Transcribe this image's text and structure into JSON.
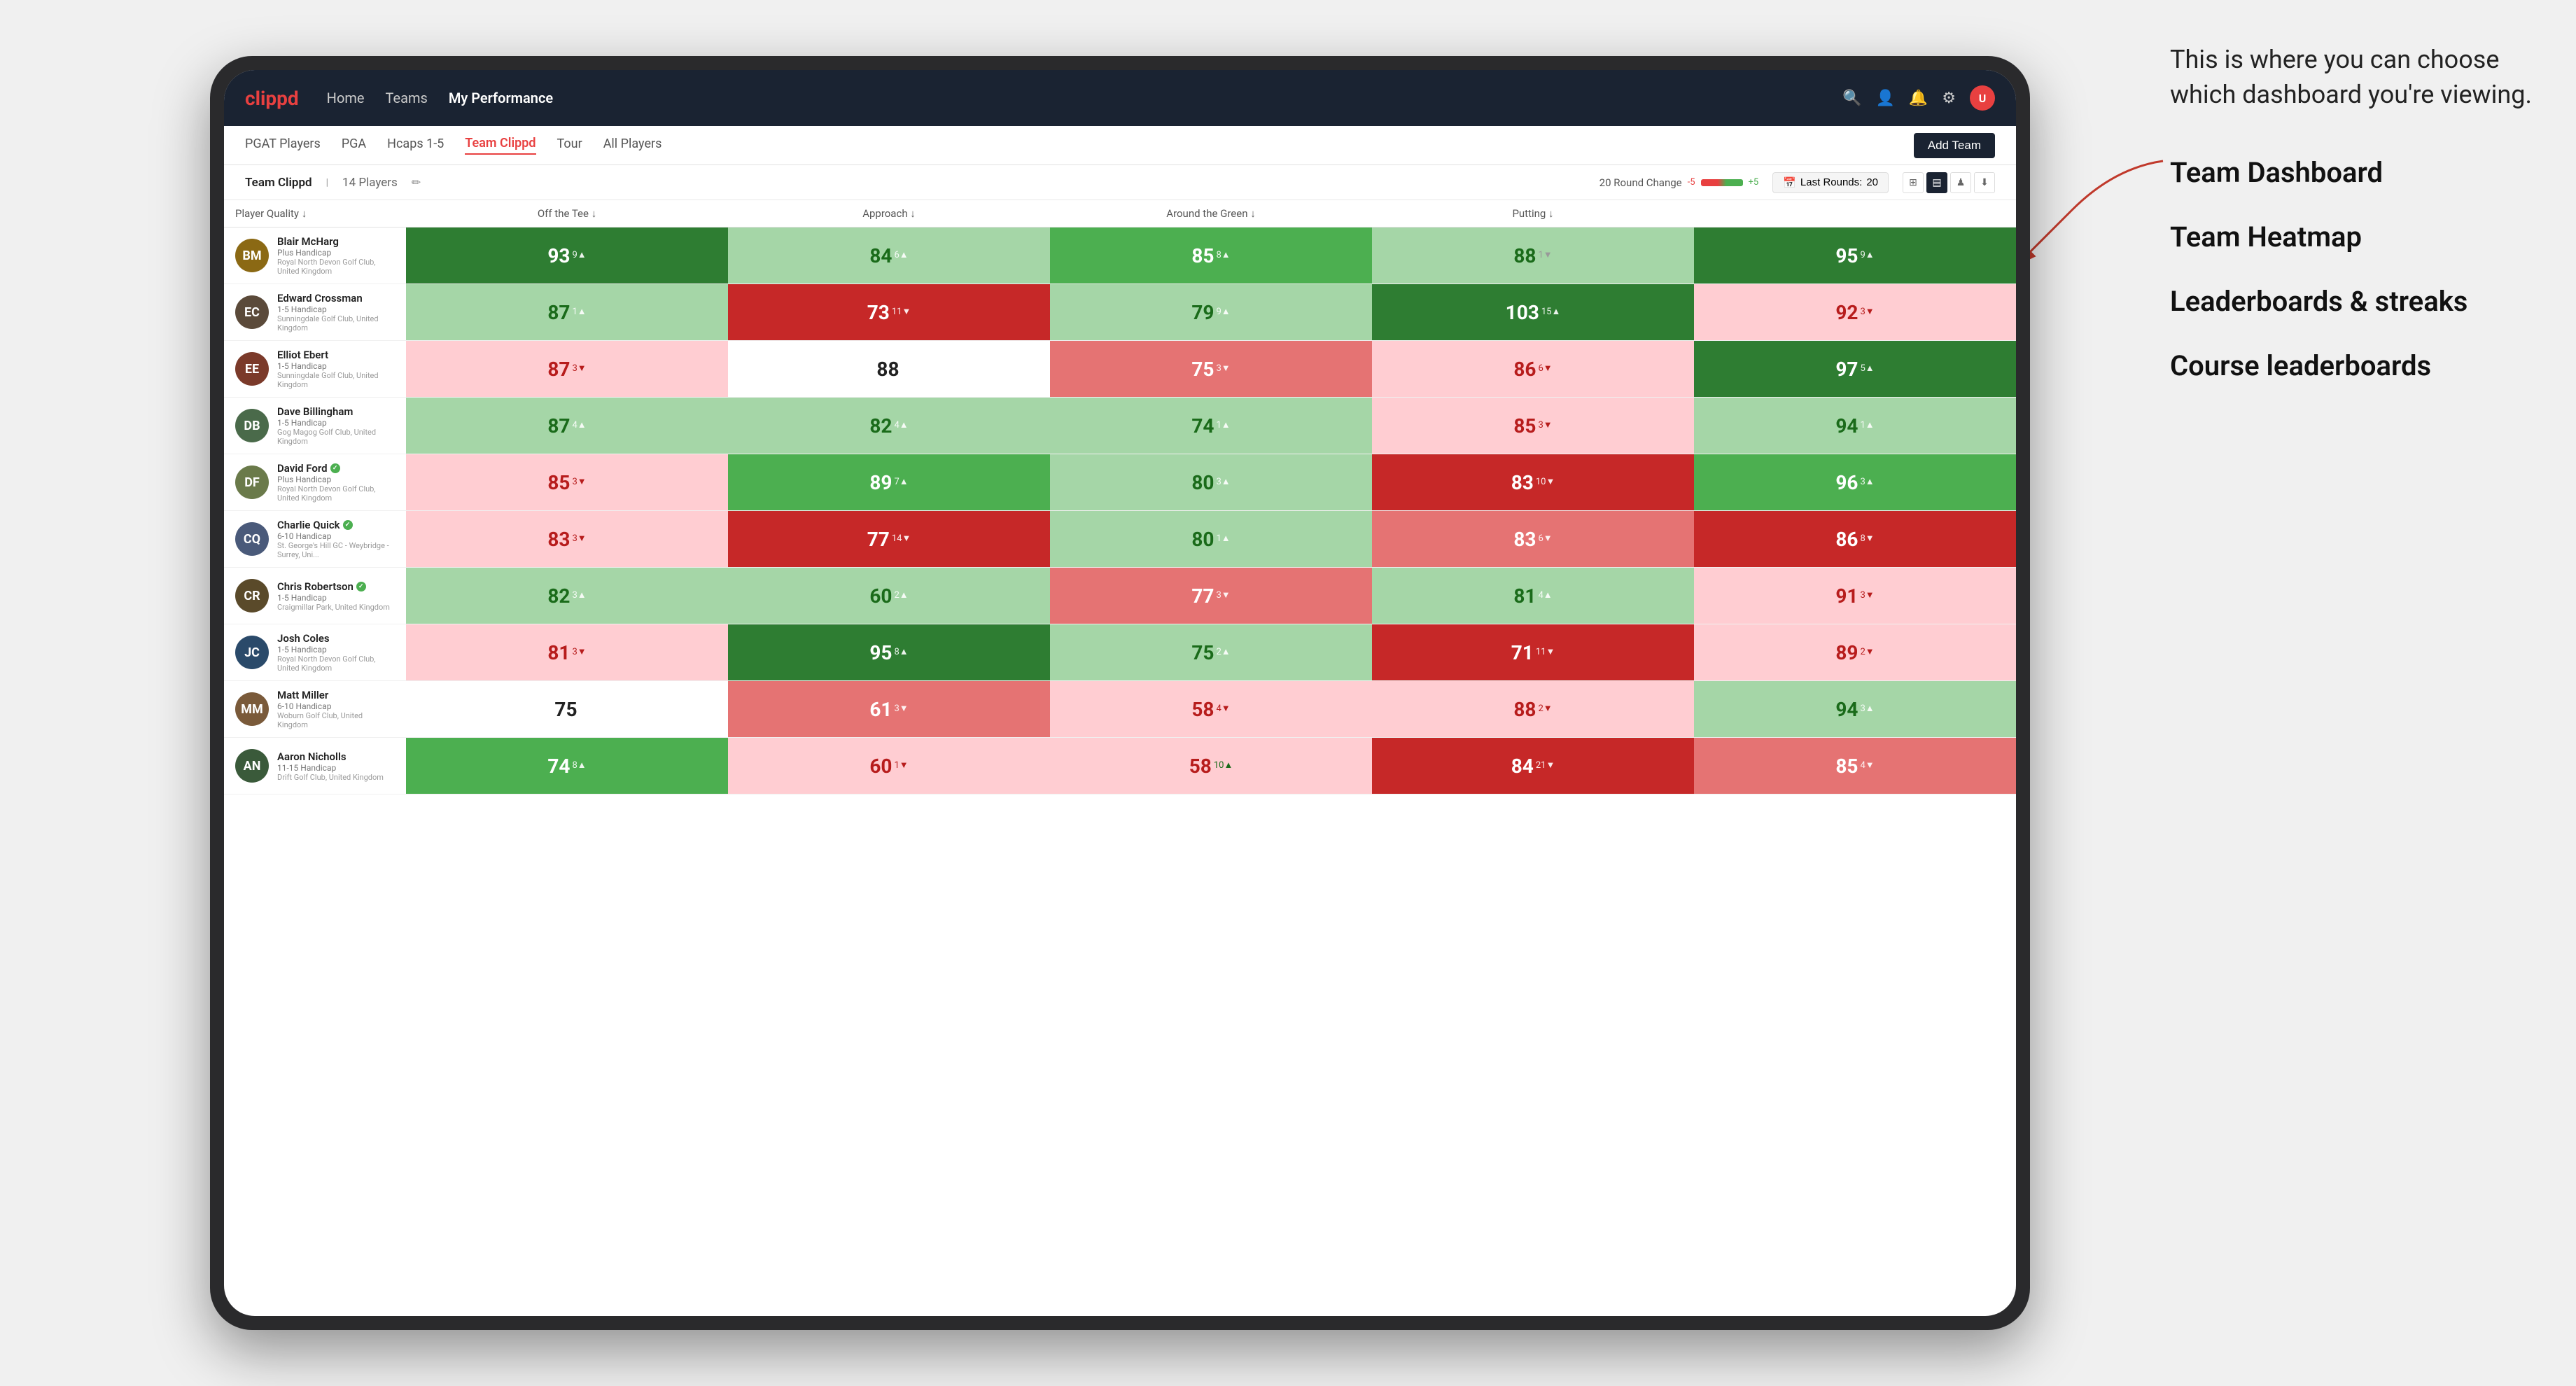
{
  "annotation": {
    "callout": "This is where you can choose which dashboard you're viewing.",
    "items": [
      "Team Dashboard",
      "Team Heatmap",
      "Leaderboards & streaks",
      "Course leaderboards"
    ]
  },
  "nav": {
    "logo": "clippd",
    "links": [
      "Home",
      "Teams",
      "My Performance"
    ],
    "active_link": "My Performance"
  },
  "sub_tabs": {
    "tabs": [
      "PGAT Players",
      "PGA",
      "Hcaps 1-5",
      "Team Clippd",
      "Tour",
      "All Players"
    ],
    "active": "Team Clippd",
    "add_btn": "Add Team"
  },
  "team_bar": {
    "name": "Team Clippd",
    "count": "14 Players",
    "round_change_label": "20 Round Change",
    "neg_value": "-5",
    "pos_value": "+5",
    "last_rounds_label": "Last Rounds:",
    "last_rounds_value": "20"
  },
  "columns": {
    "player_col": "Player Quality ↓",
    "cols": [
      "Off the Tee ↓",
      "Approach ↓",
      "Around the Green ↓",
      "Putting ↓"
    ]
  },
  "players": [
    {
      "name": "Blair McHarg",
      "handicap": "Plus Handicap",
      "club": "Royal North Devon Golf Club, United Kingdom",
      "initials": "BM",
      "avatar_color": "#8B6914",
      "scores": [
        {
          "value": 93,
          "change": "9",
          "dir": "up",
          "bg": "bg-green-strong"
        },
        {
          "value": 84,
          "change": "6",
          "dir": "up",
          "bg": "bg-green-light"
        },
        {
          "value": 85,
          "change": "8",
          "dir": "up",
          "bg": "bg-green-medium"
        },
        {
          "value": 88,
          "change": "1",
          "dir": "down",
          "bg": "bg-green-light"
        },
        {
          "value": 95,
          "change": "9",
          "dir": "up",
          "bg": "bg-green-strong"
        }
      ]
    },
    {
      "name": "Edward Crossman",
      "handicap": "1-5 Handicap",
      "club": "Sunningdale Golf Club, United Kingdom",
      "initials": "EC",
      "avatar_color": "#5B4A3A",
      "scores": [
        {
          "value": 87,
          "change": "1",
          "dir": "up",
          "bg": "bg-green-light"
        },
        {
          "value": 73,
          "change": "11",
          "dir": "down",
          "bg": "bg-red-strong"
        },
        {
          "value": 79,
          "change": "9",
          "dir": "up",
          "bg": "bg-green-light"
        },
        {
          "value": 103,
          "change": "15",
          "dir": "up",
          "bg": "bg-green-strong"
        },
        {
          "value": 92,
          "change": "3",
          "dir": "down",
          "bg": "bg-red-light"
        }
      ]
    },
    {
      "name": "Elliot Ebert",
      "handicap": "1-5 Handicap",
      "club": "Sunningdale Golf Club, United Kingdom",
      "initials": "EE",
      "avatar_color": "#7B3A2A",
      "scores": [
        {
          "value": 87,
          "change": "3",
          "dir": "down",
          "bg": "bg-red-light"
        },
        {
          "value": 88,
          "change": "",
          "dir": "",
          "bg": "bg-white"
        },
        {
          "value": 75,
          "change": "3",
          "dir": "down",
          "bg": "bg-red-medium"
        },
        {
          "value": 86,
          "change": "6",
          "dir": "down",
          "bg": "bg-red-light"
        },
        {
          "value": 97,
          "change": "5",
          "dir": "up",
          "bg": "bg-green-strong"
        }
      ]
    },
    {
      "name": "Dave Billingham",
      "handicap": "1-5 Handicap",
      "club": "Gog Magog Golf Club, United Kingdom",
      "initials": "DB",
      "avatar_color": "#4A6A4A",
      "scores": [
        {
          "value": 87,
          "change": "4",
          "dir": "up",
          "bg": "bg-green-light"
        },
        {
          "value": 82,
          "change": "4",
          "dir": "up",
          "bg": "bg-green-light"
        },
        {
          "value": 74,
          "change": "1",
          "dir": "up",
          "bg": "bg-green-light"
        },
        {
          "value": 85,
          "change": "3",
          "dir": "down",
          "bg": "bg-red-light"
        },
        {
          "value": 94,
          "change": "1",
          "dir": "up",
          "bg": "bg-green-light"
        }
      ]
    },
    {
      "name": "David Ford",
      "handicap": "Plus Handicap",
      "club": "Royal North Devon Golf Club, United Kingdom",
      "initials": "DF",
      "avatar_color": "#6A7A4A",
      "verified": true,
      "scores": [
        {
          "value": 85,
          "change": "3",
          "dir": "down",
          "bg": "bg-red-light"
        },
        {
          "value": 89,
          "change": "7",
          "dir": "up",
          "bg": "bg-green-medium"
        },
        {
          "value": 80,
          "change": "3",
          "dir": "up",
          "bg": "bg-green-light"
        },
        {
          "value": 83,
          "change": "10",
          "dir": "down",
          "bg": "bg-red-strong"
        },
        {
          "value": 96,
          "change": "3",
          "dir": "up",
          "bg": "bg-green-medium"
        }
      ]
    },
    {
      "name": "Charlie Quick",
      "handicap": "6-10 Handicap",
      "club": "St. George's Hill GC - Weybridge - Surrey, Uni...",
      "initials": "CQ",
      "avatar_color": "#4A5A7A",
      "verified": true,
      "scores": [
        {
          "value": 83,
          "change": "3",
          "dir": "down",
          "bg": "bg-red-light"
        },
        {
          "value": 77,
          "change": "14",
          "dir": "down",
          "bg": "bg-red-strong"
        },
        {
          "value": 80,
          "change": "1",
          "dir": "up",
          "bg": "bg-green-light"
        },
        {
          "value": 83,
          "change": "6",
          "dir": "down",
          "bg": "bg-red-medium"
        },
        {
          "value": 86,
          "change": "8",
          "dir": "down",
          "bg": "bg-red-strong"
        }
      ]
    },
    {
      "name": "Chris Robertson",
      "handicap": "1-5 Handicap",
      "club": "Craigmillar Park, United Kingdom",
      "initials": "CR",
      "avatar_color": "#5A4A2A",
      "verified": true,
      "scores": [
        {
          "value": 82,
          "change": "3",
          "dir": "up",
          "bg": "bg-green-light"
        },
        {
          "value": 60,
          "change": "2",
          "dir": "up",
          "bg": "bg-green-light"
        },
        {
          "value": 77,
          "change": "3",
          "dir": "down",
          "bg": "bg-red-medium"
        },
        {
          "value": 81,
          "change": "4",
          "dir": "up",
          "bg": "bg-green-light"
        },
        {
          "value": 91,
          "change": "3",
          "dir": "down",
          "bg": "bg-red-light"
        }
      ]
    },
    {
      "name": "Josh Coles",
      "handicap": "1-5 Handicap",
      "club": "Royal North Devon Golf Club, United Kingdom",
      "initials": "JC",
      "avatar_color": "#2A4A6A",
      "scores": [
        {
          "value": 81,
          "change": "3",
          "dir": "down",
          "bg": "bg-red-light"
        },
        {
          "value": 95,
          "change": "8",
          "dir": "up",
          "bg": "bg-green-strong"
        },
        {
          "value": 75,
          "change": "2",
          "dir": "up",
          "bg": "bg-green-light"
        },
        {
          "value": 71,
          "change": "11",
          "dir": "down",
          "bg": "bg-red-strong"
        },
        {
          "value": 89,
          "change": "2",
          "dir": "down",
          "bg": "bg-red-light"
        }
      ]
    },
    {
      "name": "Matt Miller",
      "handicap": "6-10 Handicap",
      "club": "Woburn Golf Club, United Kingdom",
      "initials": "MM",
      "avatar_color": "#7A5A3A",
      "scores": [
        {
          "value": 75,
          "change": "",
          "dir": "",
          "bg": "bg-white"
        },
        {
          "value": 61,
          "change": "3",
          "dir": "down",
          "bg": "bg-red-medium"
        },
        {
          "value": 58,
          "change": "4",
          "dir": "down",
          "bg": "bg-red-light"
        },
        {
          "value": 88,
          "change": "2",
          "dir": "down",
          "bg": "bg-red-light"
        },
        {
          "value": 94,
          "change": "3",
          "dir": "up",
          "bg": "bg-green-light"
        }
      ]
    },
    {
      "name": "Aaron Nicholls",
      "handicap": "11-15 Handicap",
      "club": "Drift Golf Club, United Kingdom",
      "initials": "AN",
      "avatar_color": "#3A5A3A",
      "scores": [
        {
          "value": 74,
          "change": "8",
          "dir": "up",
          "bg": "bg-green-medium"
        },
        {
          "value": 60,
          "change": "1",
          "dir": "down",
          "bg": "bg-red-light"
        },
        {
          "value": 58,
          "change": "10",
          "dir": "up",
          "bg": "bg-red-light"
        },
        {
          "value": 84,
          "change": "21",
          "dir": "down",
          "bg": "bg-red-strong"
        },
        {
          "value": 85,
          "change": "4",
          "dir": "down",
          "bg": "bg-red-medium"
        }
      ]
    }
  ]
}
